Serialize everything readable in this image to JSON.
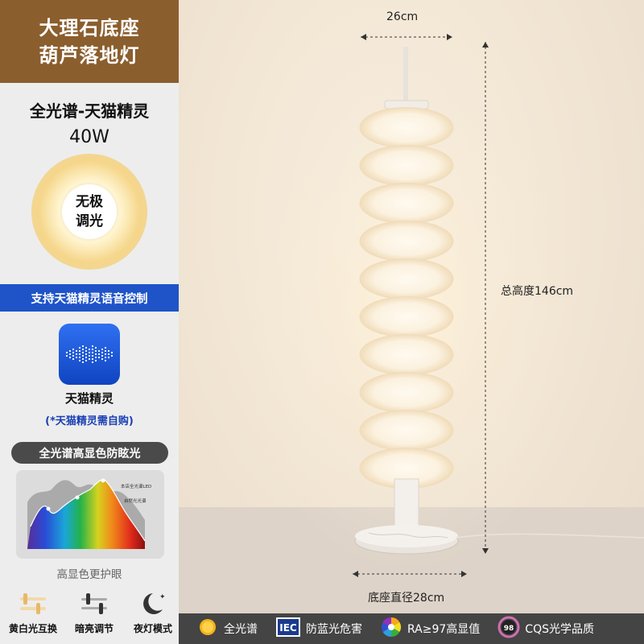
{
  "title": {
    "line1": "大理石底座",
    "line2": "葫芦落地灯"
  },
  "spec": {
    "spectrum": "全光谱-天猫精灵",
    "power": "40W"
  },
  "dimming": {
    "line1": "无极",
    "line2": "调光"
  },
  "voice_banner": "支持天猫精灵语音控制",
  "genie": {
    "label": "天猫精灵",
    "note": "(*天猫精灵需自购)"
  },
  "cri_pill": "全光谱高显色防眩光",
  "spectrum_chart": {
    "legend1": "本店全光谱LED",
    "legend2": "自然光光谱"
  },
  "spectrum_caption": "高显色更护眼",
  "features": [
    {
      "icon": "color-switch-icon",
      "label": "黄白光互换"
    },
    {
      "icon": "brightness-slider-icon",
      "label": "暗亮调节"
    },
    {
      "icon": "moon-icon",
      "label": "夜灯模式"
    }
  ],
  "dimensions": {
    "width": "26cm",
    "height": "总高度146cm",
    "base": "底座直径28cm"
  },
  "bottom_bar": [
    {
      "icon": "sun-icon",
      "label": "全光谱"
    },
    {
      "icon": "iec-icon",
      "icon_text": "IEC",
      "label": "防蓝光危害"
    },
    {
      "icon": "color-wheel-icon",
      "label": "RA≥97高显值"
    },
    {
      "icon": "cqs-badge-icon",
      "icon_text": "98",
      "label": "CQS光学品质"
    }
  ],
  "colors": {
    "title_bg": "#8b5e2e",
    "banner_blue": "#1f53c8",
    "bottom_bg": "#444444",
    "note_blue": "#1a3fb5"
  }
}
